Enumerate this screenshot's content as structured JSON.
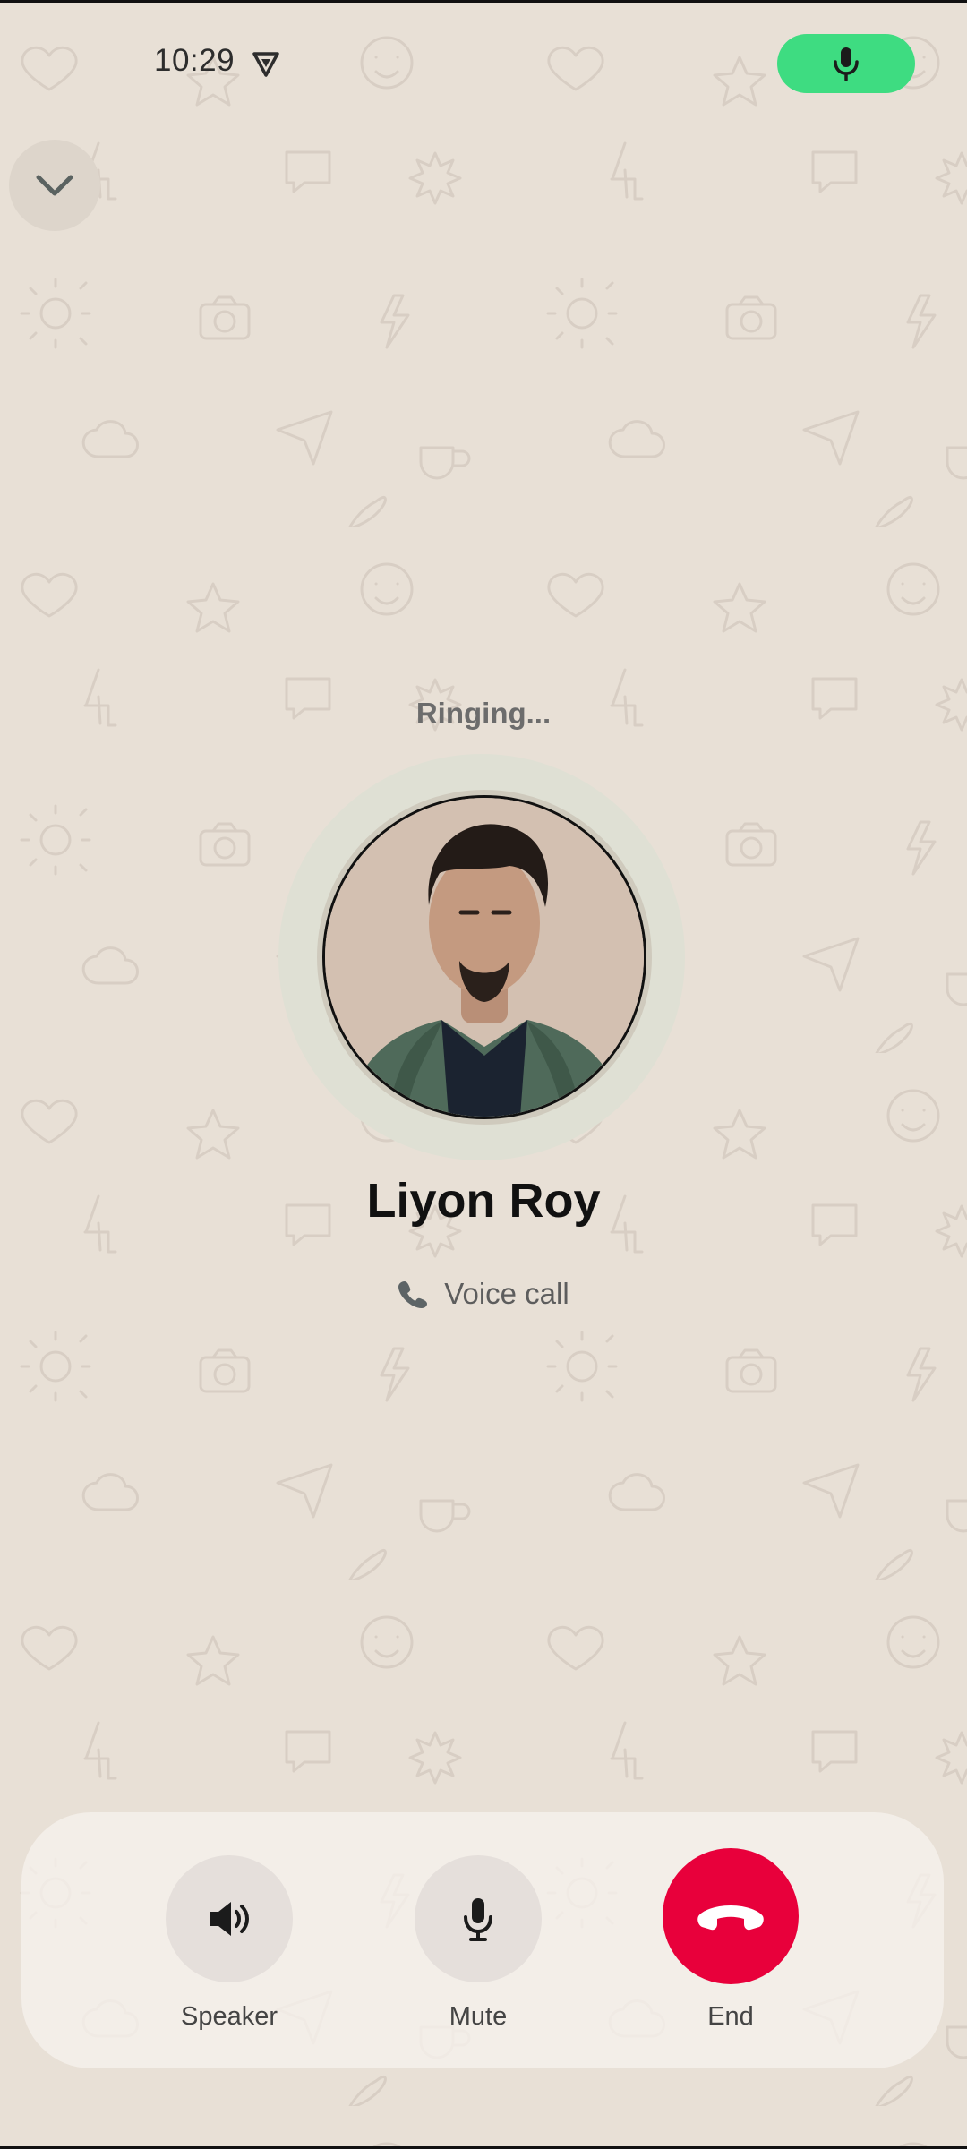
{
  "status_bar": {
    "time": "10:29"
  },
  "call": {
    "status": "Ringing...",
    "contact_name": "Liyon Roy",
    "type_label": "Voice call"
  },
  "controls": [
    {
      "label": "Speaker"
    },
    {
      "label": "Mute"
    },
    {
      "label": "End"
    }
  ],
  "colors": {
    "background": "#e8e0d6",
    "mic_active": "#3edc81",
    "end_call": "#e8003b"
  },
  "icons": {
    "collapse": "chevron-down-icon",
    "status_vpn": "vpn-shield-icon",
    "status_mic": "microphone-icon",
    "call_type": "phone-icon",
    "speaker": "speaker-icon",
    "mute": "microphone-icon",
    "end": "hang-up-icon"
  }
}
